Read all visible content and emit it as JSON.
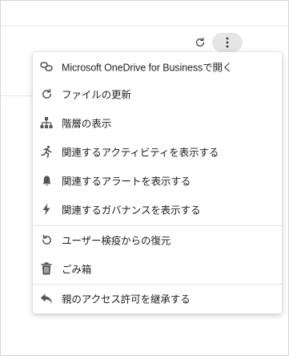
{
  "toolbar": {
    "refresh_icon": "refresh-icon",
    "more_icon": "more-vertical-icon"
  },
  "menu": {
    "items": [
      {
        "label": "Microsoft OneDrive for Businessで開く",
        "icon": "link-icon"
      },
      {
        "label": "ファイルの更新",
        "icon": "refresh-icon"
      },
      {
        "label": "階層の表示",
        "icon": "hierarchy-icon"
      },
      {
        "label": "関連するアクティビティを表示する",
        "icon": "activity-run-icon"
      },
      {
        "label": "関連するアラートを表示する",
        "icon": "bell-icon"
      },
      {
        "label": "関連するガバナンスを表示する",
        "icon": "lightning-icon"
      },
      {
        "label": "ユーザー検疫からの復元",
        "icon": "restore-icon"
      },
      {
        "label": "ごみ箱",
        "icon": "trash-icon"
      },
      {
        "label": "親のアクセス許可を継承する",
        "icon": "reply-icon"
      }
    ]
  }
}
